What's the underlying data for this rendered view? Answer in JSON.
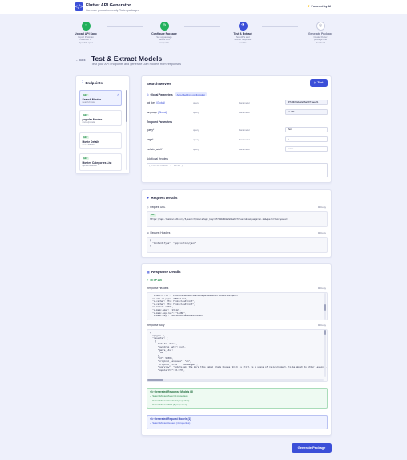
{
  "header": {
    "logo_glyph": "</>",
    "title": "Flutter API Generator",
    "subtitle": "Generate production-ready Flutter packages",
    "powered": "Powered by AI"
  },
  "steps": [
    {
      "label": "Upload API Spec",
      "desc": [
        "Import Postman",
        "collection or",
        "OpenAPI spec"
      ],
      "icon": "upload-icon",
      "glyph": "↑",
      "color": "#22b05c"
    },
    {
      "label": "Configure Package",
      "desc": [
        "Set up package",
        "details and",
        "endpoints"
      ],
      "icon": "gear-icon",
      "glyph": "⚙",
      "color": "#22b05c"
    },
    {
      "label": "Test & Extract",
      "desc": [
        "Test APIs and",
        "extract response",
        "models"
      ],
      "icon": "flask-icon",
      "glyph": "⚗",
      "color": "#3b4fd8"
    },
    {
      "label": "Generate Package",
      "desc": [
        "Create Flutter",
        "package and",
        "download"
      ],
      "icon": "package-icon",
      "glyph": "◎",
      "color": "#ffffff"
    }
  ],
  "page": {
    "back": "Back",
    "title": "Test & Extract Models",
    "subtitle": "Test your API endpoints and generate Dart models from responses"
  },
  "endpoints": {
    "title": "Endpoints",
    "items": [
      {
        "method": "GET",
        "name": "Search Movies",
        "path": "/search/movie",
        "active": true
      },
      {
        "method": "GET",
        "name": "popular Movies",
        "path": "/movie/popular",
        "active": false
      },
      {
        "method": "GET",
        "name": "Movie Details",
        "path": "/movie/550919",
        "active": false
      },
      {
        "method": "GET",
        "name": "Movies Categories List",
        "path": "/genre/movie/list",
        "active": false
      }
    ]
  },
  "test": {
    "title": "Search Movies",
    "test_button": "Test",
    "global_label": "Global Parameters",
    "auto_fill": "Auto-filled from configuration",
    "global_params": [
      {
        "name": "api_key",
        "tag": "(Global)",
        "type": "query",
        "kind": "Parameter",
        "value": "df7d9b64de2a96a6977aeef1"
      },
      {
        "name": "language",
        "tag": "(Global)",
        "type": "query",
        "kind": "Parameter",
        "value": "en-US"
      }
    ],
    "endpoint_label": "Endpoint Parameters",
    "endpoint_params": [
      {
        "name": "query*",
        "type": "query",
        "kind": "Parameter",
        "value": "thor",
        "placeholder": ""
      },
      {
        "name": "page*",
        "type": "query",
        "kind": "Parameter",
        "value": "1",
        "placeholder": ""
      },
      {
        "name": "include_adult*",
        "type": "query",
        "kind": "Parameter",
        "value": "",
        "placeholder": "Enter"
      }
    ],
    "headers_label": "Additional Headers",
    "headers_placeholder": "{\"Custom-Header\": \"value\"}"
  },
  "request": {
    "title": "Request Details",
    "url_label": "Request URL",
    "copy": "Copy",
    "method": "GET",
    "url": "https://api.themoviedb.org/3/search/movie?api_key=df7d9b64de2a96a6977aeef1&language=en-US&query=thor&page=1",
    "headers_label": "Request Headers",
    "headers_code": "{\n  \"Content-Type\": \"application/json\"\n}"
  },
  "response": {
    "title": "Response Details",
    "status": "HTTP 200",
    "headers_label": "Response Headers",
    "copy": "Copy",
    "headers_code": "  \"x-amz-cf-id\": \"ZLMPOMnW1Nrd6DfsaazzR9eqDMMENAbkbnFdp4bD1VvNfgwx==\",\n  \"x-amz-cf-pop\": \"MRS52-P1\",\n  \"x-cache\": \"Hit from cloudfront\",\n  \"x-cache\": \"Hit from cloudfront\",\n  \"x-memc\": \"HIT\",\n  \"x-memc-age\": \"13512\",\n  \"x-memc-expires\": \"14288\",\n  \"x-memc-key\": \"8ef4b5ecb3ea2bae9f7a59bf\"",
    "body_label": "Response Body",
    "body_code": "{\n  \"page\": 1,\n  \"results\": [\n    {\n      \"adult\": false,\n      \"backdrop_path\": null,\n      \"genre_ids\": [\n        18\n      ],\n      \"id\": 99388,\n      \"original_language\": \"en\",\n      \"original_title\": \"Thorberger\",\n      \"overview\": \"Robots and the more this rebel drama houses which is still is a scene of reincarnement. to be about to other lessons\",\n      \"popularity\": 0.0776,",
    "gen_response_title": "Generated Response Models (3)",
    "gen_response_items": [
      "SearchMoviesModel (4 properties)",
      "SearchMoviesResult (14 properties)",
      "SearchMoviesDWS (8 properties)"
    ],
    "gen_request_title": "Generated Request Models (1)",
    "gen_request_items": [
      "SearchMoviesRequest (4 properties)"
    ]
  },
  "footer": {
    "generate_button": "Generate Package"
  }
}
